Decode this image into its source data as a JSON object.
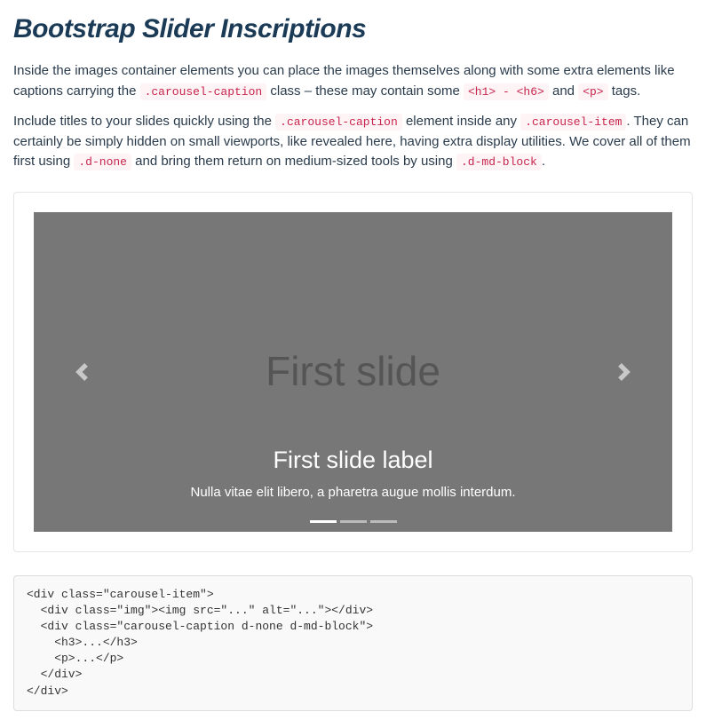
{
  "heading": "Bootstrap Slider Inscriptions",
  "para1": {
    "t1": "Inside the images container elements you can place the images themselves along with some extra elements like captions carrying the ",
    "c1": ".carousel-caption",
    "t2": " class – these may contain some ",
    "c2": "<h1> - <h6>",
    "t3": " and ",
    "c3": "<p>",
    "t4": " tags."
  },
  "para2": {
    "t1": "Include titles to your slides quickly using the ",
    "c1": ".carousel-caption",
    "t2": " element inside any ",
    "c2": ".carousel-item",
    "t3": ". They can certainly be simply hidden on small viewports, like revealed here, having extra display utilities. We cover all of them first using ",
    "c3": ".d-none",
    "t4": " and bring them return on medium-sized tools by using ",
    "c4": ".d-md-block",
    "t5": "."
  },
  "carousel": {
    "placeholder": "First slide",
    "caption_title": "First slide label",
    "caption_text": "Nulla vitae elit libero, a pharetra augue mollis interdum."
  },
  "code": "<div class=\"carousel-item\">\n  <div class=\"img\"><img src=\"...\" alt=\"...\"></div>\n  <div class=\"carousel-caption d-none d-md-block\">\n    <h3>...</h3>\n    <p>...</p>\n  </div>\n</div>"
}
